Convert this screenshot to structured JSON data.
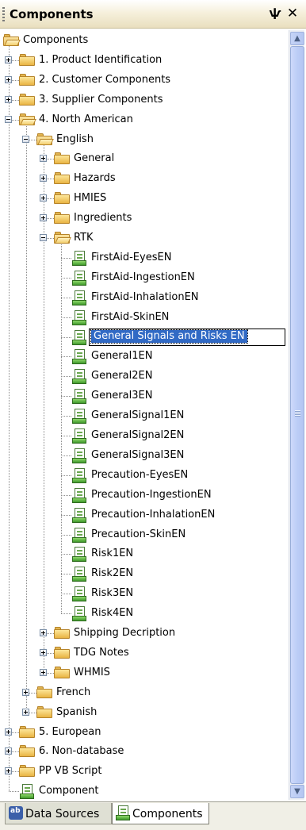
{
  "panel": {
    "title": "Components",
    "pin_glyph": "ѱ",
    "close_glyph": "✕"
  },
  "tree": {
    "root_label": "Components",
    "nodes": [
      {
        "label": "Components",
        "icon": "open-folder-icon",
        "level": 0,
        "expander": "none"
      },
      {
        "label": "1. Product Identification",
        "icon": "folder-icon",
        "level": 1,
        "expander": "plus"
      },
      {
        "label": "2. Customer Components",
        "icon": "folder-icon",
        "level": 1,
        "expander": "plus"
      },
      {
        "label": "3. Supplier Components",
        "icon": "folder-icon",
        "level": 1,
        "expander": "plus"
      },
      {
        "label": "4. North American",
        "icon": "open-folder-icon",
        "level": 1,
        "expander": "minus"
      },
      {
        "label": "English",
        "icon": "open-folder-icon",
        "level": 2,
        "expander": "minus"
      },
      {
        "label": "General",
        "icon": "folder-icon",
        "level": 3,
        "expander": "plus"
      },
      {
        "label": "Hazards",
        "icon": "folder-icon",
        "level": 3,
        "expander": "plus"
      },
      {
        "label": "HMIES",
        "icon": "folder-icon",
        "level": 3,
        "expander": "plus"
      },
      {
        "label": "Ingredients",
        "icon": "folder-icon",
        "level": 3,
        "expander": "plus"
      },
      {
        "label": "RTK",
        "icon": "open-folder-icon",
        "level": 3,
        "expander": "minus"
      },
      {
        "label": "FirstAid-EyesEN",
        "icon": "component-icon",
        "level": 4
      },
      {
        "label": "FirstAid-IngestionEN",
        "icon": "component-icon",
        "level": 4
      },
      {
        "label": "FirstAid-InhalationEN",
        "icon": "component-icon",
        "level": 4
      },
      {
        "label": "FirstAid-SkinEN",
        "icon": "component-icon",
        "level": 4
      },
      {
        "label": "General Signals and Risks EN",
        "icon": "component-icon",
        "level": 4,
        "editing": true
      },
      {
        "label": "General1EN",
        "icon": "component-icon",
        "level": 4
      },
      {
        "label": "General2EN",
        "icon": "component-icon",
        "level": 4
      },
      {
        "label": "General3EN",
        "icon": "component-icon",
        "level": 4
      },
      {
        "label": "GeneralSignal1EN",
        "icon": "component-icon",
        "level": 4
      },
      {
        "label": "GeneralSignal2EN",
        "icon": "component-icon",
        "level": 4
      },
      {
        "label": "GeneralSignal3EN",
        "icon": "component-icon",
        "level": 4
      },
      {
        "label": "Precaution-EyesEN",
        "icon": "component-icon",
        "level": 4
      },
      {
        "label": "Precaution-IngestionEN",
        "icon": "component-icon",
        "level": 4
      },
      {
        "label": "Precaution-InhalationEN",
        "icon": "component-icon",
        "level": 4
      },
      {
        "label": "Precaution-SkinEN",
        "icon": "component-icon",
        "level": 4
      },
      {
        "label": "Risk1EN",
        "icon": "component-icon",
        "level": 4
      },
      {
        "label": "Risk2EN",
        "icon": "component-icon",
        "level": 4
      },
      {
        "label": "Risk3EN",
        "icon": "component-icon",
        "level": 4
      },
      {
        "label": "Risk4EN",
        "icon": "component-icon",
        "level": 4
      },
      {
        "label": "Shipping Decription",
        "icon": "folder-icon",
        "level": 3,
        "expander": "plus"
      },
      {
        "label": "TDG Notes",
        "icon": "folder-icon",
        "level": 3,
        "expander": "plus"
      },
      {
        "label": "WHMIS",
        "icon": "folder-icon",
        "level": 3,
        "expander": "plus"
      },
      {
        "label": "French",
        "icon": "folder-icon",
        "level": 2,
        "expander": "plus"
      },
      {
        "label": "Spanish",
        "icon": "folder-icon",
        "level": 2,
        "expander": "plus"
      },
      {
        "label": "5. European",
        "icon": "folder-icon",
        "level": 1,
        "expander": "plus"
      },
      {
        "label": "6. Non-database",
        "icon": "folder-icon",
        "level": 1,
        "expander": "plus"
      },
      {
        "label": "PP VB Script",
        "icon": "folder-icon",
        "level": 1,
        "expander": "plus"
      },
      {
        "label": "Component",
        "icon": "component-icon",
        "level": 1
      }
    ]
  },
  "scrollbar": {
    "up_glyph": "▲",
    "down_glyph": "▼"
  },
  "tabs": [
    {
      "label": "Data Sources",
      "icon": "data-sources-icon",
      "active": false
    },
    {
      "label": "Components",
      "icon": "component-icon",
      "active": true
    }
  ],
  "colors": {
    "selection": "#316ac5",
    "titlebar": "#efe7cd",
    "scrollbar_thumb": "#bccdf6"
  }
}
